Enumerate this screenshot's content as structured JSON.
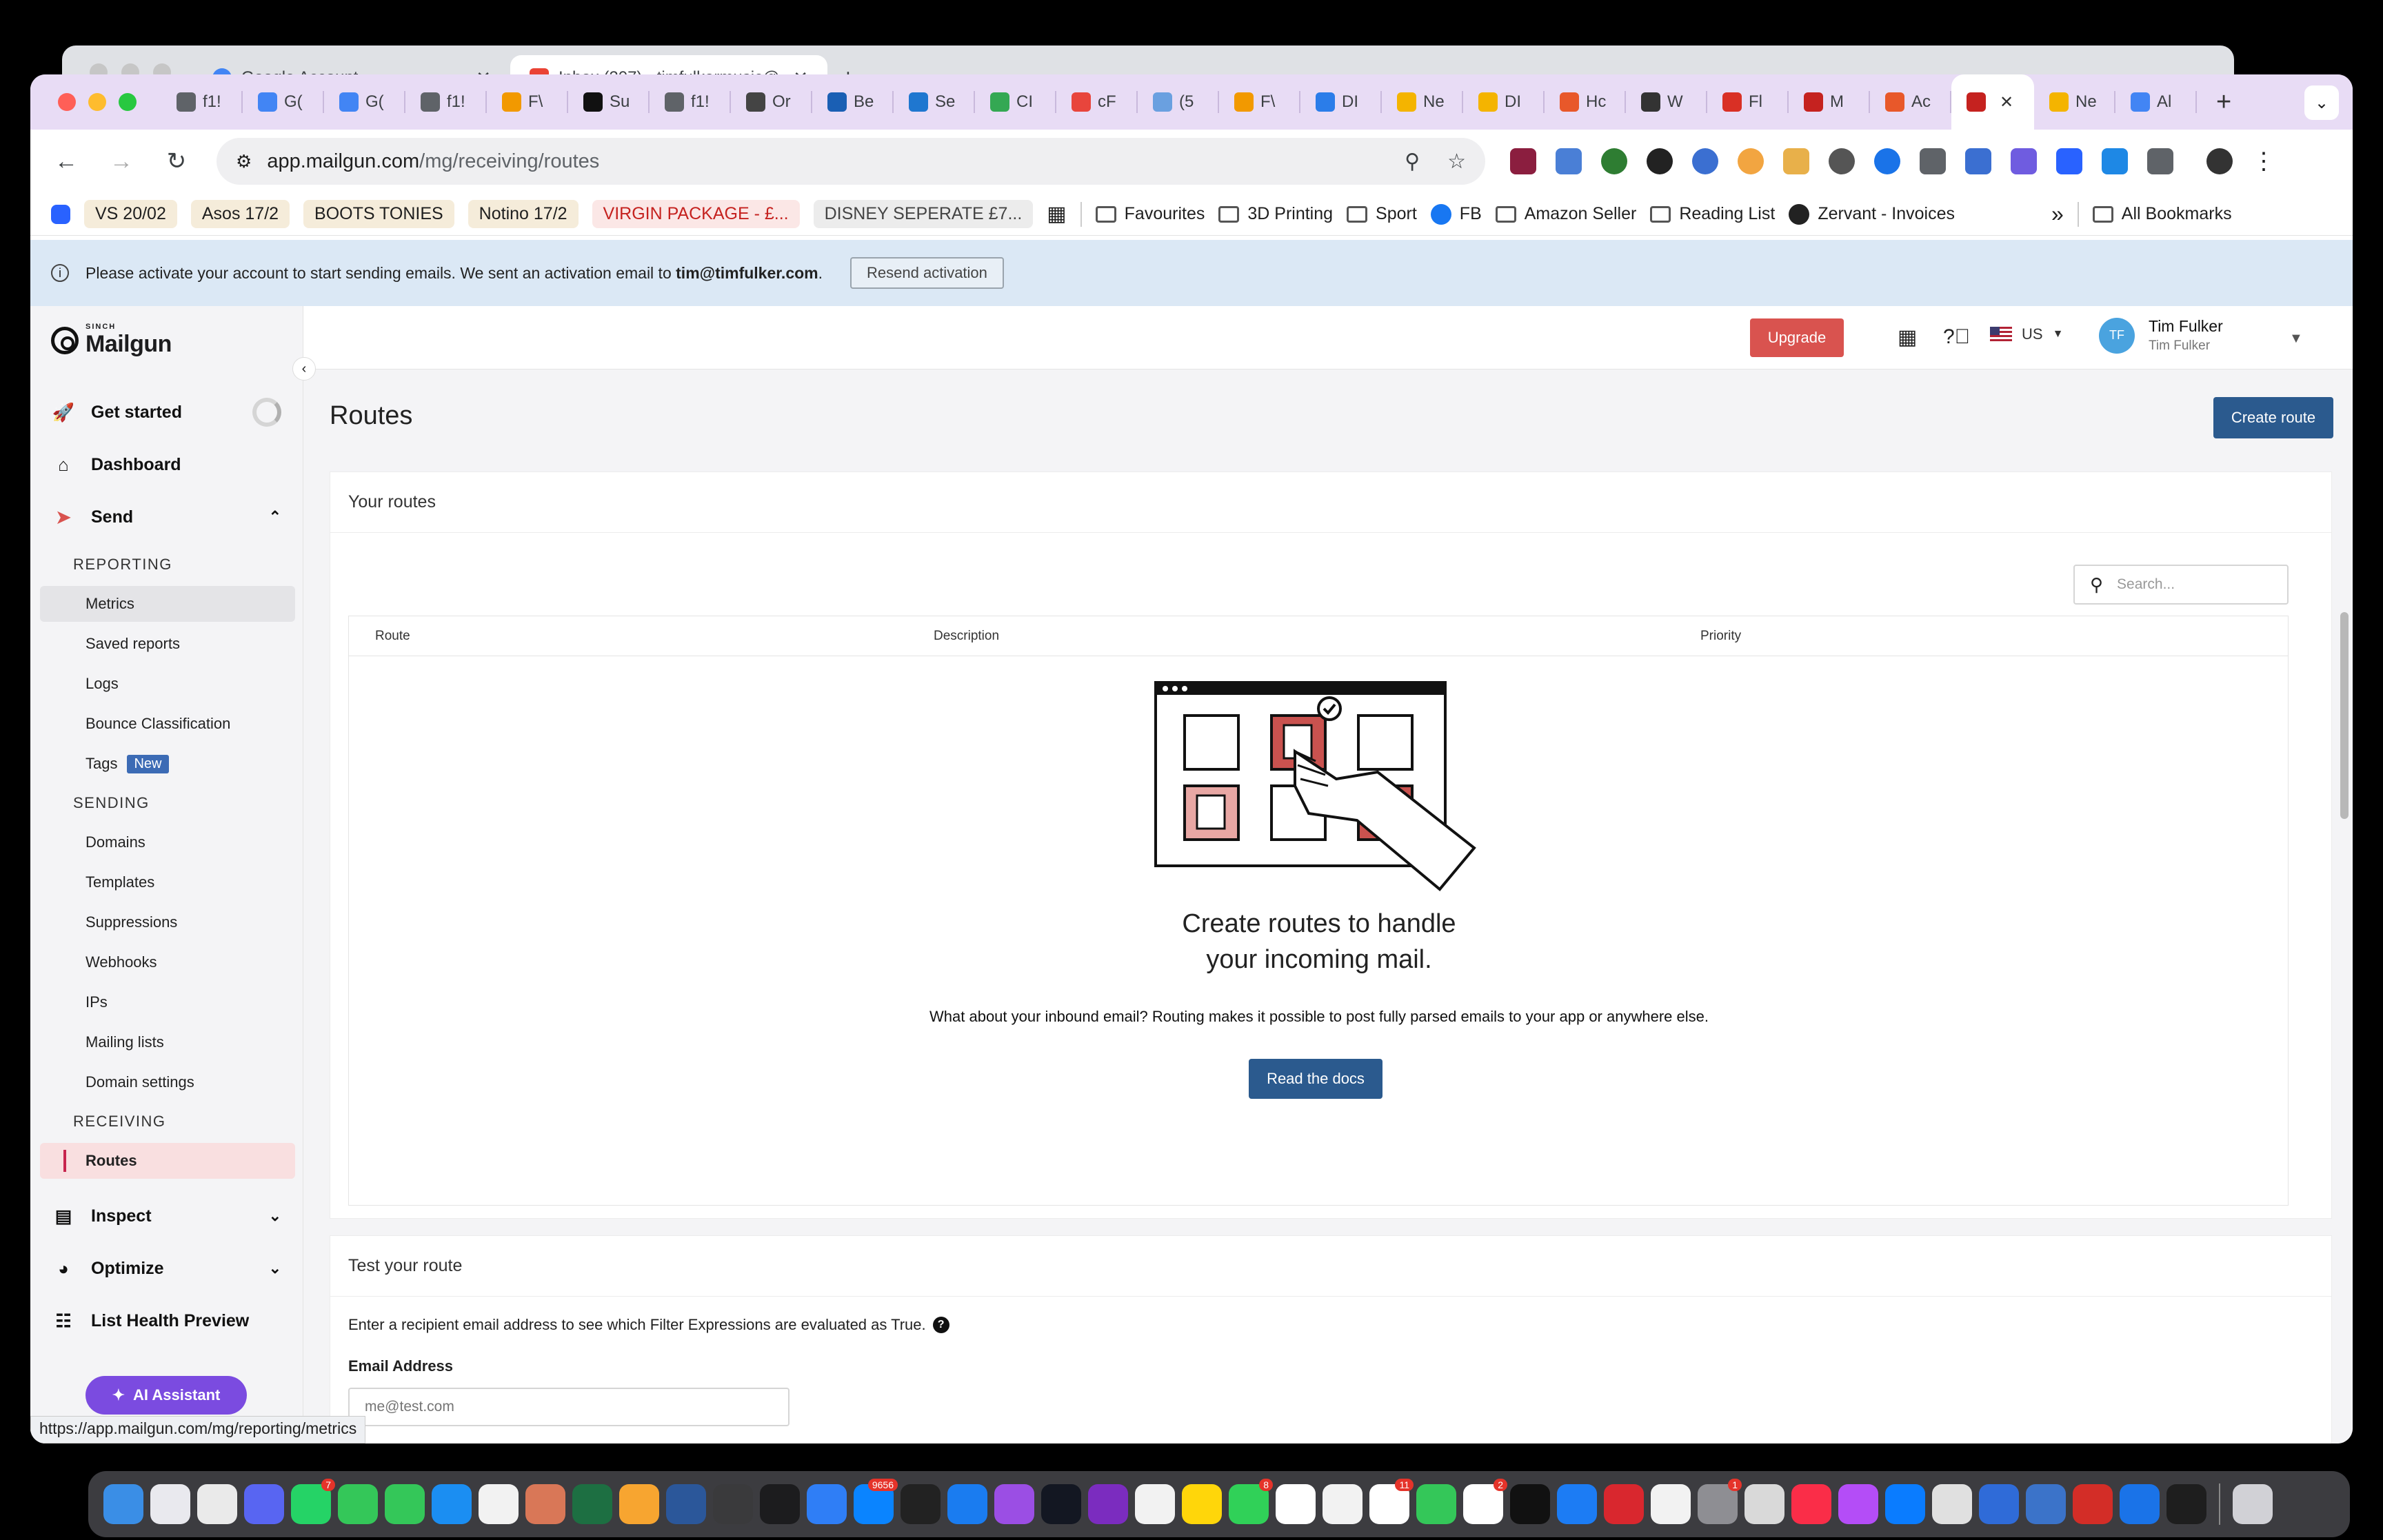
{
  "background_window": {
    "tabs": [
      {
        "label": "Google Account",
        "favicon_color": "#4285f4",
        "active": false
      },
      {
        "label": "Inbox (207) - timfulkermusic@",
        "favicon_color": "#ea4335",
        "active": true
      }
    ]
  },
  "browser": {
    "tabs": [
      {
        "label": "f1!",
        "favicon_color": "#5f6368"
      },
      {
        "label": "G(",
        "favicon_color": "#4285f4"
      },
      {
        "label": "G(",
        "favicon_color": "#4285f4"
      },
      {
        "label": "f1!",
        "favicon_color": "#5f6368"
      },
      {
        "label": "F\\",
        "favicon_color": "#f29900"
      },
      {
        "label": "Su",
        "favicon_color": "#111111"
      },
      {
        "label": "f1!",
        "favicon_color": "#5f6368"
      },
      {
        "label": "Or",
        "favicon_color": "#444444"
      },
      {
        "label": "Be",
        "favicon_color": "#1a5fb4"
      },
      {
        "label": "Se",
        "favicon_color": "#1f77d0"
      },
      {
        "label": "CI",
        "favicon_color": "#34a853"
      },
      {
        "label": "cF",
        "favicon_color": "#e8453c"
      },
      {
        "label": "(5",
        "favicon_color": "#6aa0e0"
      },
      {
        "label": "F\\",
        "favicon_color": "#f29900"
      },
      {
        "label": "DI",
        "favicon_color": "#2b7de9"
      },
      {
        "label": "Ne",
        "favicon_color": "#f4b400"
      },
      {
        "label": "DI",
        "favicon_color": "#f4b400"
      },
      {
        "label": "Hc",
        "favicon_color": "#e8582a"
      },
      {
        "label": "W",
        "favicon_color": "#333333"
      },
      {
        "label": "Fl",
        "favicon_color": "#d93025"
      },
      {
        "label": "M",
        "favicon_color": "#c5221f"
      },
      {
        "label": "Ac",
        "favicon_color": "#e8582a"
      },
      {
        "label": "",
        "favicon_color": "#c5221f",
        "active": true
      },
      {
        "label": "Ne",
        "favicon_color": "#f4b400"
      },
      {
        "label": "Al",
        "favicon_color": "#4285f4"
      }
    ],
    "url_host": "app.mailgun.com",
    "url_path": "/mg/receiving/routes",
    "bookmarks": {
      "pills": [
        {
          "label": "VS 20/02",
          "style": "tan"
        },
        {
          "label": "Asos 17/2",
          "style": "tan"
        },
        {
          "label": "BOOTS TONIES",
          "style": "tan"
        },
        {
          "label": "Notino 17/2",
          "style": "tan"
        },
        {
          "label": "VIRGIN PACKAGE - £...",
          "style": "red"
        },
        {
          "label": "DISNEY SEPERATE £7...",
          "style": "grey"
        }
      ],
      "folders": [
        "Favourites",
        "3D Printing",
        "Sport"
      ],
      "fb_label": "FB",
      "folders2": [
        "Amazon Seller",
        "Reading List"
      ],
      "zervant_label": "Zervant - Invoices",
      "overflow": "»",
      "all_bookmarks": "All Bookmarks"
    },
    "status_url": "https://app.mailgun.com/mg/reporting/metrics"
  },
  "banner": {
    "text": "Please activate your account to start sending emails. We sent an activation email to",
    "email": "tim@timfulker.com",
    "period": ".",
    "button": "Resend activation"
  },
  "sidebar": {
    "logo_small": "SINCH",
    "logo_name": "Mailgun",
    "get_started": "Get started",
    "dashboard": "Dashboard",
    "send": "Send",
    "reporting_heading": "REPORTING",
    "reporting_items": [
      "Metrics",
      "Saved reports",
      "Logs",
      "Bounce Classification",
      "Tags"
    ],
    "tags_badge": "New",
    "sending_heading": "SENDING",
    "sending_items": [
      "Domains",
      "Templates",
      "Suppressions",
      "Webhooks",
      "IPs",
      "Mailing lists",
      "Domain settings"
    ],
    "receiving_heading": "RECEIVING",
    "receiving_items": [
      "Routes"
    ],
    "inspect": "Inspect",
    "optimize": "Optimize",
    "list_health": "List Health Preview",
    "ai_assistant": "AI Assistant"
  },
  "header": {
    "upgrade": "Upgrade",
    "region": "US",
    "avatar_initials": "TF",
    "user_name": "Tim Fulker",
    "user_sub": "Tim Fulker"
  },
  "routes": {
    "title": "Routes",
    "create_button": "Create route",
    "card_title": "Your routes",
    "search_placeholder": "Search...",
    "columns": [
      "Route",
      "Description",
      "Priority"
    ],
    "empty_title_line1": "Create routes to handle",
    "empty_title_line2": "your incoming mail.",
    "empty_sub": "What about your inbound email? Routing makes it possible to post fully parsed emails to your app or anywhere else.",
    "docs_button": "Read the docs"
  },
  "test_route": {
    "title": "Test your route",
    "description": "Enter a recipient email address to see which Filter Expressions are evaluated as True.",
    "field_label": "Email Address",
    "field_placeholder": "me@test.com"
  },
  "dock": {
    "apps": [
      {
        "name": "finder",
        "color": "#3a8ee6"
      },
      {
        "name": "launchpad",
        "color": "#e9e9ee"
      },
      {
        "name": "chrome",
        "color": "#eaeaea"
      },
      {
        "name": "discord",
        "color": "#5865f2"
      },
      {
        "name": "whatsapp",
        "color": "#25d366",
        "badge": "7"
      },
      {
        "name": "numbers",
        "color": "#34c759"
      },
      {
        "name": "messages",
        "color": "#34c759"
      },
      {
        "name": "testflight",
        "color": "#1b8ef2"
      },
      {
        "name": "chatgpt",
        "color": "#f2f2f2"
      },
      {
        "name": "claude",
        "color": "#d97757"
      },
      {
        "name": "excel",
        "color": "#1d6f42"
      },
      {
        "name": "pages",
        "color": "#f7a530"
      },
      {
        "name": "word",
        "color": "#2b579a"
      },
      {
        "name": "screenshot",
        "color": "#3a3a3c"
      },
      {
        "name": "terminal",
        "color": "#1c1c1e"
      },
      {
        "name": "mail",
        "color": "#2f7ef6"
      },
      {
        "name": "appstore-connect",
        "color": "#0a84ff",
        "badge": "9656"
      },
      {
        "name": "final-cut",
        "color": "#222222"
      },
      {
        "name": "safari",
        "color": "#1a7cf0"
      },
      {
        "name": "podcasts",
        "color": "#9b4ee4"
      },
      {
        "name": "tradingview",
        "color": "#131722"
      },
      {
        "name": "nova",
        "color": "#7b2cbf"
      },
      {
        "name": "photos",
        "color": "#f2f2f2"
      },
      {
        "name": "notes",
        "color": "#ffd60a"
      },
      {
        "name": "facetime",
        "color": "#30d158",
        "badge": "8"
      },
      {
        "name": "calendar",
        "color": "#ffffff"
      },
      {
        "name": "translate",
        "color": "#f2f2f2"
      },
      {
        "name": "calendar2",
        "color": "#ffffff",
        "badge": "11"
      },
      {
        "name": "findmy",
        "color": "#34c759"
      },
      {
        "name": "reminders",
        "color": "#ffffff",
        "badge": "2"
      },
      {
        "name": "appletv",
        "color": "#111111"
      },
      {
        "name": "appstore",
        "color": "#1c7cf4"
      },
      {
        "name": "affinity",
        "color": "#d9272e"
      },
      {
        "name": "freeform",
        "color": "#f2f2f2"
      },
      {
        "name": "system-settings",
        "color": "#8e8e93",
        "badge": "1"
      },
      {
        "name": "preview",
        "color": "#d9d9d9"
      },
      {
        "name": "music",
        "color": "#fa2d48"
      },
      {
        "name": "speeko",
        "color": "#b44df7"
      },
      {
        "name": "messenger",
        "color": "#0a7cff"
      },
      {
        "name": "pencil",
        "color": "#e0e0e0"
      },
      {
        "name": "roblox",
        "color": "#2f6bd8"
      },
      {
        "name": "preview2",
        "color": "#3b73c9"
      },
      {
        "name": "lastpass",
        "color": "#d32d27"
      },
      {
        "name": "1password",
        "color": "#1a73e8"
      },
      {
        "name": "figma",
        "color": "#1e1e1e"
      },
      {
        "name": "trash",
        "color": "#d1d1d6"
      }
    ]
  }
}
